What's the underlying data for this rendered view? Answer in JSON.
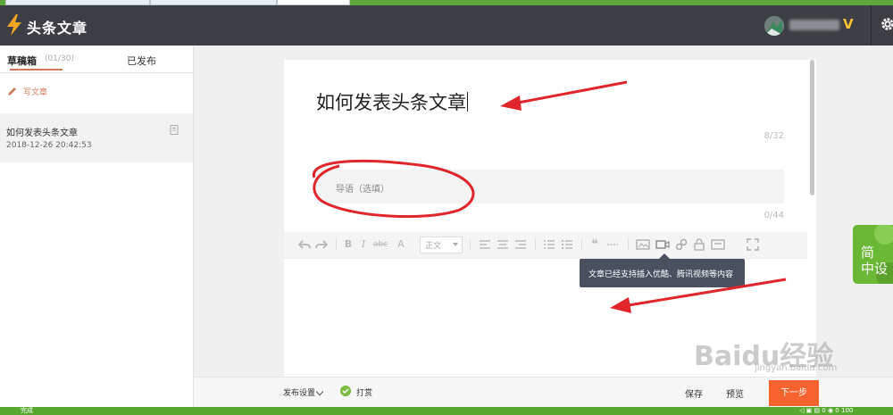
{
  "header": {
    "title": "头条文章",
    "badge": "V",
    "accent": "#f5a623"
  },
  "sidebar": {
    "tab_drafts": "草稿箱",
    "draft_count": "(01/30)",
    "tab_published": "已发布",
    "write_label": "写文章",
    "article": {
      "title": "如何发表头条文章",
      "date": "2018-12-26 20:42:53"
    }
  },
  "editor": {
    "title_value": "如何发表头条文章",
    "title_count": "8/32",
    "lead_placeholder": "导语（选填）",
    "lead_count": "0/44",
    "toolbar": {
      "format_value": "正文",
      "icons": [
        "undo-icon",
        "redo-icon",
        "bold-icon",
        "italic-icon",
        "strikethrough-icon",
        "font-size-icon",
        "align-left-icon",
        "align-center-icon",
        "align-right-icon",
        "ordered-list-icon",
        "unordered-list-icon",
        "quote-icon",
        "divider-icon",
        "image-icon",
        "video-icon",
        "link-icon",
        "bag-icon",
        "card-icon",
        "fullscreen-icon"
      ],
      "abc": "abc",
      "a_icon": "A",
      "bold": "B",
      "italic": "I",
      "quote": "❝"
    },
    "tooltip": "文章已经支持插入优酷、腾讯视频等内容"
  },
  "bottom_bar": {
    "publish_settings": "发布设置",
    "reward": "打赏",
    "save": "保存",
    "preview": "预览",
    "next": "下一步"
  },
  "side_badge": "简\n中设",
  "status_bar": {
    "text": "完成",
    "right": "100"
  },
  "watermark": {
    "brand": "Baidu经验",
    "url": "jingyan.baidu.com"
  },
  "colors": {
    "header_bg": "#3e3f44",
    "accent": "#d17a5b",
    "next_button": "#f7632e",
    "annotation_red": "#e0262b",
    "status_green": "#56a82f"
  }
}
